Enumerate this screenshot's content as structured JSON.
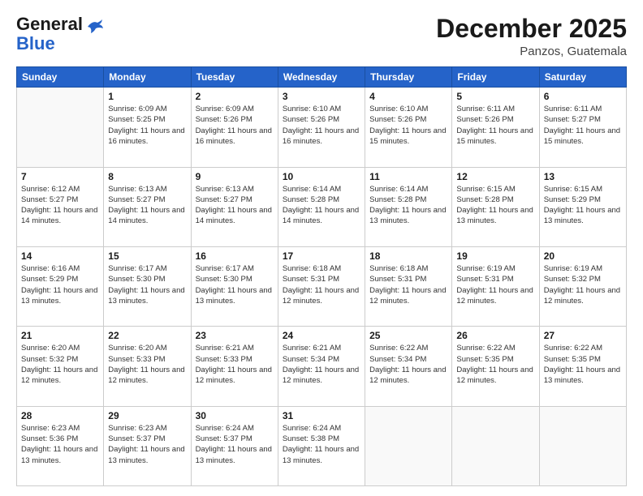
{
  "header": {
    "logo_general": "General",
    "logo_blue": "Blue",
    "month_title": "December 2025",
    "location": "Panzos, Guatemala"
  },
  "weekdays": [
    "Sunday",
    "Monday",
    "Tuesday",
    "Wednesday",
    "Thursday",
    "Friday",
    "Saturday"
  ],
  "weeks": [
    [
      {
        "day": "",
        "sunrise": "",
        "sunset": "",
        "daylight": ""
      },
      {
        "day": "1",
        "sunrise": "Sunrise: 6:09 AM",
        "sunset": "Sunset: 5:25 PM",
        "daylight": "Daylight: 11 hours and 16 minutes."
      },
      {
        "day": "2",
        "sunrise": "Sunrise: 6:09 AM",
        "sunset": "Sunset: 5:26 PM",
        "daylight": "Daylight: 11 hours and 16 minutes."
      },
      {
        "day": "3",
        "sunrise": "Sunrise: 6:10 AM",
        "sunset": "Sunset: 5:26 PM",
        "daylight": "Daylight: 11 hours and 16 minutes."
      },
      {
        "day": "4",
        "sunrise": "Sunrise: 6:10 AM",
        "sunset": "Sunset: 5:26 PM",
        "daylight": "Daylight: 11 hours and 15 minutes."
      },
      {
        "day": "5",
        "sunrise": "Sunrise: 6:11 AM",
        "sunset": "Sunset: 5:26 PM",
        "daylight": "Daylight: 11 hours and 15 minutes."
      },
      {
        "day": "6",
        "sunrise": "Sunrise: 6:11 AM",
        "sunset": "Sunset: 5:27 PM",
        "daylight": "Daylight: 11 hours and 15 minutes."
      }
    ],
    [
      {
        "day": "7",
        "sunrise": "Sunrise: 6:12 AM",
        "sunset": "Sunset: 5:27 PM",
        "daylight": "Daylight: 11 hours and 14 minutes."
      },
      {
        "day": "8",
        "sunrise": "Sunrise: 6:13 AM",
        "sunset": "Sunset: 5:27 PM",
        "daylight": "Daylight: 11 hours and 14 minutes."
      },
      {
        "day": "9",
        "sunrise": "Sunrise: 6:13 AM",
        "sunset": "Sunset: 5:27 PM",
        "daylight": "Daylight: 11 hours and 14 minutes."
      },
      {
        "day": "10",
        "sunrise": "Sunrise: 6:14 AM",
        "sunset": "Sunset: 5:28 PM",
        "daylight": "Daylight: 11 hours and 14 minutes."
      },
      {
        "day": "11",
        "sunrise": "Sunrise: 6:14 AM",
        "sunset": "Sunset: 5:28 PM",
        "daylight": "Daylight: 11 hours and 13 minutes."
      },
      {
        "day": "12",
        "sunrise": "Sunrise: 6:15 AM",
        "sunset": "Sunset: 5:28 PM",
        "daylight": "Daylight: 11 hours and 13 minutes."
      },
      {
        "day": "13",
        "sunrise": "Sunrise: 6:15 AM",
        "sunset": "Sunset: 5:29 PM",
        "daylight": "Daylight: 11 hours and 13 minutes."
      }
    ],
    [
      {
        "day": "14",
        "sunrise": "Sunrise: 6:16 AM",
        "sunset": "Sunset: 5:29 PM",
        "daylight": "Daylight: 11 hours and 13 minutes."
      },
      {
        "day": "15",
        "sunrise": "Sunrise: 6:17 AM",
        "sunset": "Sunset: 5:30 PM",
        "daylight": "Daylight: 11 hours and 13 minutes."
      },
      {
        "day": "16",
        "sunrise": "Sunrise: 6:17 AM",
        "sunset": "Sunset: 5:30 PM",
        "daylight": "Daylight: 11 hours and 13 minutes."
      },
      {
        "day": "17",
        "sunrise": "Sunrise: 6:18 AM",
        "sunset": "Sunset: 5:31 PM",
        "daylight": "Daylight: 11 hours and 12 minutes."
      },
      {
        "day": "18",
        "sunrise": "Sunrise: 6:18 AM",
        "sunset": "Sunset: 5:31 PM",
        "daylight": "Daylight: 11 hours and 12 minutes."
      },
      {
        "day": "19",
        "sunrise": "Sunrise: 6:19 AM",
        "sunset": "Sunset: 5:31 PM",
        "daylight": "Daylight: 11 hours and 12 minutes."
      },
      {
        "day": "20",
        "sunrise": "Sunrise: 6:19 AM",
        "sunset": "Sunset: 5:32 PM",
        "daylight": "Daylight: 11 hours and 12 minutes."
      }
    ],
    [
      {
        "day": "21",
        "sunrise": "Sunrise: 6:20 AM",
        "sunset": "Sunset: 5:32 PM",
        "daylight": "Daylight: 11 hours and 12 minutes."
      },
      {
        "day": "22",
        "sunrise": "Sunrise: 6:20 AM",
        "sunset": "Sunset: 5:33 PM",
        "daylight": "Daylight: 11 hours and 12 minutes."
      },
      {
        "day": "23",
        "sunrise": "Sunrise: 6:21 AM",
        "sunset": "Sunset: 5:33 PM",
        "daylight": "Daylight: 11 hours and 12 minutes."
      },
      {
        "day": "24",
        "sunrise": "Sunrise: 6:21 AM",
        "sunset": "Sunset: 5:34 PM",
        "daylight": "Daylight: 11 hours and 12 minutes."
      },
      {
        "day": "25",
        "sunrise": "Sunrise: 6:22 AM",
        "sunset": "Sunset: 5:34 PM",
        "daylight": "Daylight: 11 hours and 12 minutes."
      },
      {
        "day": "26",
        "sunrise": "Sunrise: 6:22 AM",
        "sunset": "Sunset: 5:35 PM",
        "daylight": "Daylight: 11 hours and 12 minutes."
      },
      {
        "day": "27",
        "sunrise": "Sunrise: 6:22 AM",
        "sunset": "Sunset: 5:35 PM",
        "daylight": "Daylight: 11 hours and 13 minutes."
      }
    ],
    [
      {
        "day": "28",
        "sunrise": "Sunrise: 6:23 AM",
        "sunset": "Sunset: 5:36 PM",
        "daylight": "Daylight: 11 hours and 13 minutes."
      },
      {
        "day": "29",
        "sunrise": "Sunrise: 6:23 AM",
        "sunset": "Sunset: 5:37 PM",
        "daylight": "Daylight: 11 hours and 13 minutes."
      },
      {
        "day": "30",
        "sunrise": "Sunrise: 6:24 AM",
        "sunset": "Sunset: 5:37 PM",
        "daylight": "Daylight: 11 hours and 13 minutes."
      },
      {
        "day": "31",
        "sunrise": "Sunrise: 6:24 AM",
        "sunset": "Sunset: 5:38 PM",
        "daylight": "Daylight: 11 hours and 13 minutes."
      },
      {
        "day": "",
        "sunrise": "",
        "sunset": "",
        "daylight": ""
      },
      {
        "day": "",
        "sunrise": "",
        "sunset": "",
        "daylight": ""
      },
      {
        "day": "",
        "sunrise": "",
        "sunset": "",
        "daylight": ""
      }
    ]
  ]
}
